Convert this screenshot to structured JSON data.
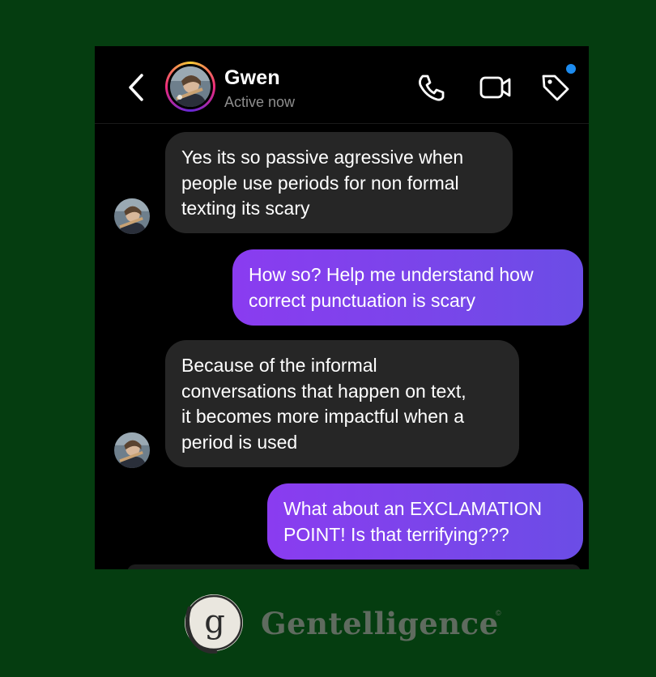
{
  "header": {
    "contact_name": "Gwen",
    "status": "Active now",
    "icons": [
      "chevron-left-icon",
      "phone-icon",
      "video-camera-icon",
      "tag-icon"
    ],
    "notification_color": "#1d8cf0"
  },
  "messages": [
    {
      "direction": "incoming",
      "lines": [
        "Yes its so passive agressive when",
        "people use periods for non formal",
        "texting its scary"
      ]
    },
    {
      "direction": "outgoing",
      "lines": [
        "How so? Help me understand how",
        "correct punctuation is scary"
      ]
    },
    {
      "direction": "incoming",
      "lines": [
        "Because of the informal",
        "conversations that happen on text,",
        "it becomes more impactful when a",
        "period is used"
      ]
    },
    {
      "direction": "outgoing",
      "lines": [
        "What about an EXCLAMATION",
        "POINT! Is that terrifying???"
      ]
    }
  ],
  "branding": {
    "logo_letter": "g",
    "name": "Gentelligence",
    "mark": "©"
  },
  "colors": {
    "background": "#053d10",
    "incoming_bubble": "#262626",
    "outgoing_bubble_start": "#8a3cf0",
    "outgoing_bubble_end": "#6b4de6",
    "brand_text": "#5f6b5f"
  }
}
